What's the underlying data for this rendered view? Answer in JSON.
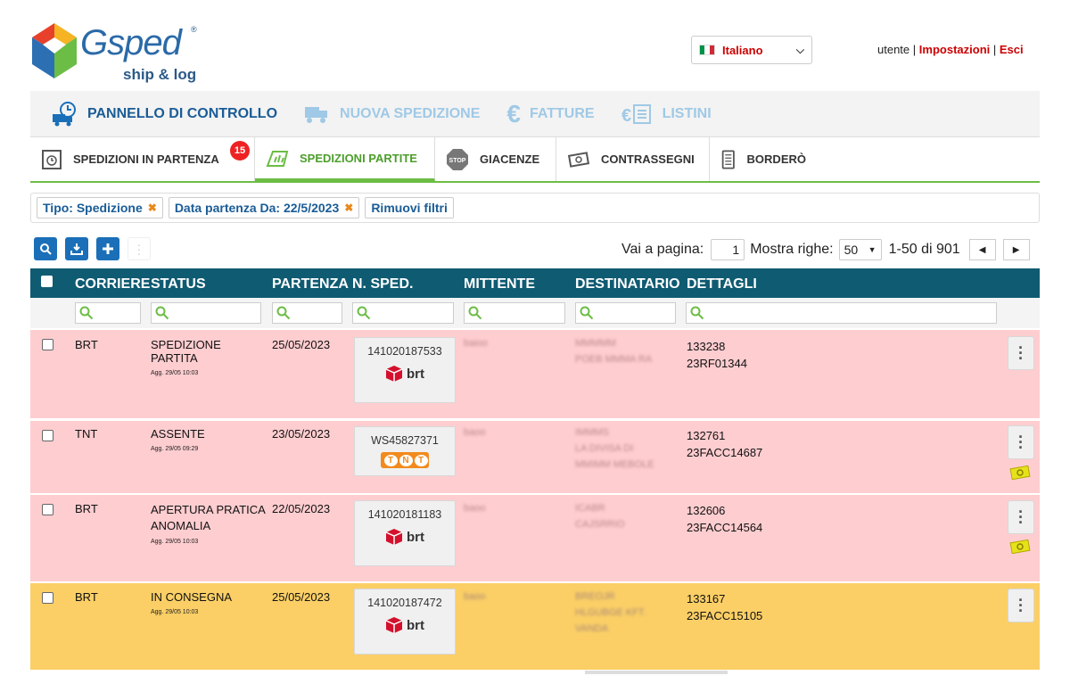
{
  "brand": {
    "name": "Gsped",
    "tagline": "ship & log",
    "reg": "®",
    "colors": {
      "primary": "#1a5c96",
      "accent": "#6cbd45",
      "header": "#0f5b72",
      "pink": "#fecdd0",
      "orange": "#fbcf66"
    }
  },
  "language": {
    "label": "Italiano"
  },
  "user": {
    "name": "utente",
    "sep": "|",
    "settings": "Impostazioni",
    "logout": "Esci"
  },
  "mainnav": [
    {
      "label": "PANNELLO DI CONTROLLO",
      "icon": "truck-clock-icon"
    },
    {
      "label": "NUOVA SPEDIZIONE",
      "icon": "truck-add-icon"
    },
    {
      "label": "FATTURE",
      "icon": "euro-icon"
    },
    {
      "label": "LISTINI",
      "icon": "price-list-icon"
    }
  ],
  "tabs": [
    {
      "label": "SPEDIZIONI IN PARTENZA",
      "badge": "15",
      "icon": "departure-icon"
    },
    {
      "label": "SPEDIZIONI PARTITE",
      "icon": "departed-icon"
    },
    {
      "label": "GIACENZE",
      "icon": "stop-icon"
    },
    {
      "label": "CONTRASSEGNI",
      "icon": "cash-icon"
    },
    {
      "label": "BORDERÒ",
      "icon": "document-icon"
    }
  ],
  "filters": [
    {
      "label": "Tipo: Spedizione",
      "remove": "✖"
    },
    {
      "label": "Data partenza Da: 22/5/2023",
      "remove": "✖"
    }
  ],
  "clear_filters": "Rimuovi filtri",
  "pager": {
    "goto_label": "Vai a pagina:",
    "page": "1",
    "rows_label": "Mostra righe:",
    "rows": "50",
    "range": "1-50 di 901"
  },
  "columns": {
    "carrier": "CORRIERE",
    "status": "STATUS",
    "departure": "PARTENZA",
    "number": "N. SPED.",
    "sender": "MITTENTE",
    "recipient": "DESTINATARIO",
    "details": "DETTAGLI"
  },
  "rows": [
    {
      "carrier": "BRT",
      "status": "SPEDIZIONE PARTITA",
      "status2": "",
      "updated": "Agg. 29/05 10:03",
      "date": "25/05/2023",
      "number": "141020187533",
      "logo": "brt",
      "sender": "baioo",
      "recipient": [
        "MMMMM",
        "POEB MMMA RA"
      ],
      "detail1": "133238",
      "detail2": "23RF01344"
    },
    {
      "carrier": "TNT",
      "status": "ASSENTE",
      "status2": "",
      "updated": "Agg. 29/05 09:29",
      "date": "23/05/2023",
      "number": "WS45827371",
      "logo": "tnt",
      "sender": "baoo",
      "recipient": [
        "IMMMS",
        "LA DIVISA DI",
        "MMIMM MEBOLE"
      ],
      "detail1": "132761",
      "detail2": "23FACC14687"
    },
    {
      "carrier": "BRT",
      "status": "APERTURA PRATICA",
      "status2": "ANOMALIA",
      "updated": "Agg. 29/05 10:03",
      "date": "22/05/2023",
      "number": "141020181183",
      "logo": "brt",
      "sender": "baoo",
      "recipient": [
        "ICABR",
        "CAJSRRIO"
      ],
      "detail1": "132606",
      "detail2": "23FACC14564"
    },
    {
      "carrier": "BRT",
      "status": "IN CONSEGNA",
      "status2": "",
      "updated": "Agg. 29/05 10:03",
      "date": "25/05/2023",
      "number": "141020187472",
      "logo": "brt",
      "sender": "baoo",
      "recipient": [
        "BREOJR",
        "HLGUBGE KFT.",
        "VANDA"
      ],
      "detail1": "133167",
      "detail2": "23FACC15105"
    }
  ]
}
